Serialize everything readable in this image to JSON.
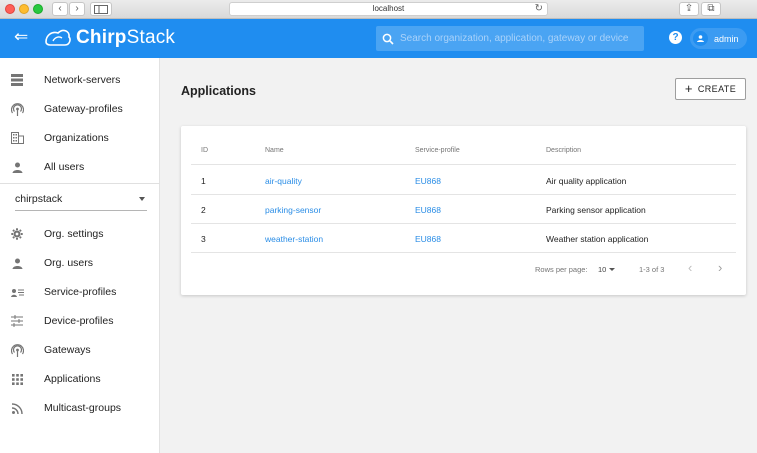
{
  "browser": {
    "url": "localhost",
    "back_glyph": "‹",
    "fwd_glyph": "›",
    "reload_glyph": "↻",
    "share_glyph": "⇪",
    "tabs_glyph": "⧉"
  },
  "header": {
    "back_glyph": "⇐",
    "logo_text_a": "Chirp",
    "logo_text_b": "Stack",
    "search_placeholder": "Search organization, application, gateway or device",
    "help_glyph": "?",
    "username": "admin",
    "accent_color": "#1f8df0"
  },
  "sidebar": {
    "top_items": [
      {
        "label": "Network-servers",
        "icon": "server-icon"
      },
      {
        "label": "Gateway-profiles",
        "icon": "wifi-tower-icon"
      },
      {
        "label": "Organizations",
        "icon": "building-icon"
      },
      {
        "label": "All users",
        "icon": "user-icon"
      }
    ],
    "org_select": "chirpstack",
    "org_items": [
      {
        "label": "Org. settings",
        "icon": "gear-icon"
      },
      {
        "label": "Org. users",
        "icon": "user-icon"
      },
      {
        "label": "Service-profiles",
        "icon": "user-list-icon"
      },
      {
        "label": "Device-profiles",
        "icon": "tune-icon"
      },
      {
        "label": "Gateways",
        "icon": "wifi-tower-icon"
      },
      {
        "label": "Applications",
        "icon": "grid-icon"
      },
      {
        "label": "Multicast-groups",
        "icon": "rss-icon"
      }
    ]
  },
  "main": {
    "title": "Applications",
    "create_label": "CREATE",
    "create_glyph": "+",
    "table": {
      "headers": [
        "ID",
        "Name",
        "Service-profile",
        "Description"
      ],
      "rows": [
        {
          "id": "1",
          "name": "air-quality",
          "service_profile": "EU868",
          "description": "Air quality application"
        },
        {
          "id": "2",
          "name": "parking-sensor",
          "service_profile": "EU868",
          "description": "Parking sensor application"
        },
        {
          "id": "3",
          "name": "weather-station",
          "service_profile": "EU868",
          "description": "Weather station application"
        }
      ]
    },
    "pagination": {
      "rows_per_page_label": "Rows per page:",
      "rows_per_page": "10",
      "range": "1-3 of 3",
      "prev_glyph": "‹",
      "next_glyph": "›"
    }
  }
}
